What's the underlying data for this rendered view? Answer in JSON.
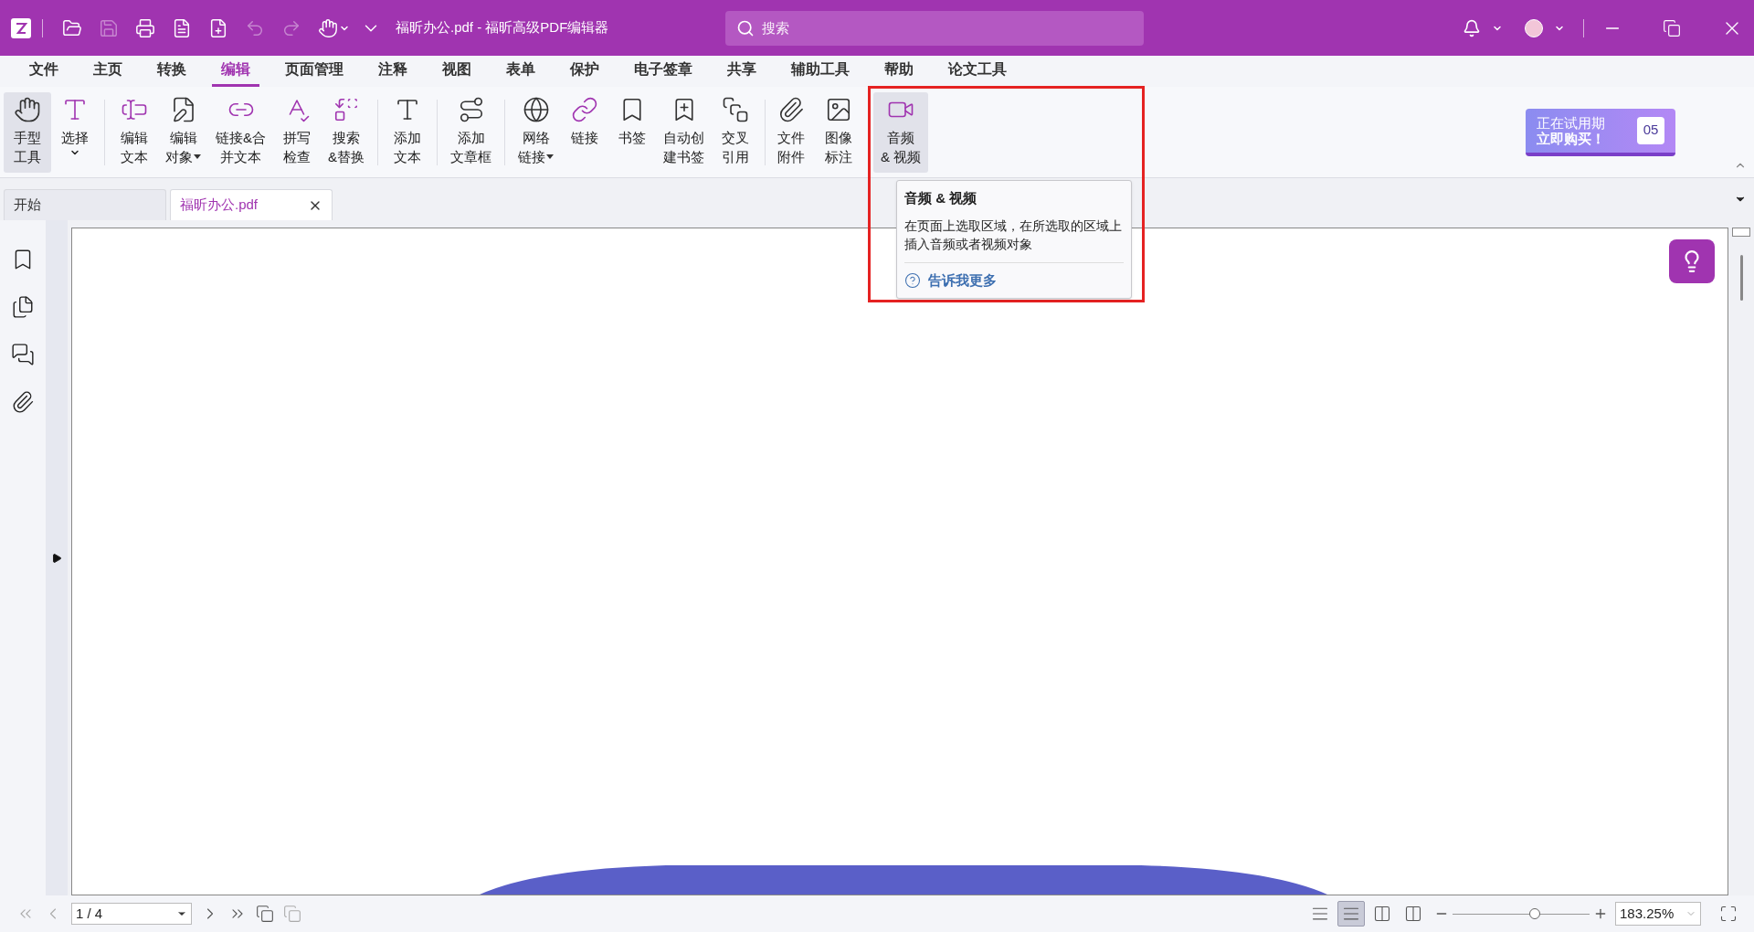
{
  "title_bar": {
    "quick_access": [
      {
        "kind": "open",
        "disabled": false
      },
      {
        "kind": "save",
        "disabled": true
      },
      {
        "kind": "print",
        "disabled": false
      },
      {
        "kind": "file",
        "disabled": false
      },
      {
        "kind": "new",
        "disabled": false
      },
      {
        "kind": "undo",
        "disabled": true
      },
      {
        "kind": "redo",
        "disabled": true
      },
      {
        "kind": "hand",
        "disabled": false
      }
    ],
    "title": "福昕办公.pdf - 福昕高级PDF编辑器",
    "search": {
      "placeholder": "搜索"
    }
  },
  "menu": [
    {
      "label": "文件",
      "selected": false
    },
    {
      "label": "主页",
      "selected": false
    },
    {
      "label": "转换",
      "selected": false
    },
    {
      "label": "编辑",
      "selected": true
    },
    {
      "label": "页面管理",
      "selected": false
    },
    {
      "label": "注释",
      "selected": false
    },
    {
      "label": "视图",
      "selected": false
    },
    {
      "label": "表单",
      "selected": false
    },
    {
      "label": "保护",
      "selected": false
    },
    {
      "label": "电子签章",
      "selected": false
    },
    {
      "label": "共享",
      "selected": false
    },
    {
      "label": "辅助工具",
      "selected": false
    },
    {
      "label": "帮助",
      "selected": false
    },
    {
      "label": "论文工具",
      "selected": false
    }
  ],
  "ribbon": {
    "groups": [
      {
        "items": [
          {
            "kind": "hand",
            "lines": [
              "手型",
              "工具"
            ],
            "dropdown": false,
            "selected": true
          },
          {
            "kind": "select",
            "lines": [
              "选择"
            ],
            "dropdown": true,
            "selected": false
          }
        ]
      },
      {
        "items": [
          {
            "kind": "edit-text",
            "lines": [
              "编辑",
              "文本"
            ],
            "dropdown": false,
            "selected": false
          },
          {
            "kind": "edit-object",
            "lines": [
              "编辑",
              "对象"
            ],
            "dropdown": true,
            "selected": false
          },
          {
            "kind": "link-merge",
            "lines": [
              "链接&合",
              "并文本"
            ],
            "dropdown": false,
            "selected": false
          },
          {
            "kind": "spell",
            "lines": [
              "拼写",
              "检查"
            ],
            "dropdown": false,
            "selected": false
          },
          {
            "kind": "replace",
            "lines": [
              "搜索",
              "&替换"
            ],
            "dropdown": false,
            "selected": false
          }
        ]
      },
      {
        "items": [
          {
            "kind": "add-text",
            "lines": [
              "添加",
              "文本"
            ],
            "dropdown": false,
            "selected": false
          }
        ]
      },
      {
        "items": [
          {
            "kind": "article",
            "lines": [
              "添加",
              "文章框"
            ],
            "dropdown": false,
            "selected": false
          }
        ]
      },
      {
        "items": [
          {
            "kind": "web-link",
            "lines": [
              "网络",
              "链接"
            ],
            "dropdown": true,
            "selected": false
          },
          {
            "kind": "link",
            "lines": [
              "链接"
            ],
            "dropdown": false,
            "selected": false
          },
          {
            "kind": "bookmark",
            "lines": [
              "书签"
            ],
            "dropdown": false,
            "selected": false
          },
          {
            "kind": "auto-bookmark",
            "lines": [
              "自动创",
              "建书签"
            ],
            "dropdown": false,
            "selected": false
          },
          {
            "kind": "cross-ref",
            "lines": [
              "交叉",
              "引用"
            ],
            "dropdown": false,
            "selected": false
          }
        ]
      },
      {
        "items": [
          {
            "kind": "attachment",
            "lines": [
              "文件",
              "附件"
            ],
            "dropdown": false,
            "selected": false
          },
          {
            "kind": "image-annot",
            "lines": [
              "图像",
              "标注"
            ],
            "dropdown": false,
            "selected": false
          },
          {
            "kind": "media",
            "lines": [
              "音频",
              "& 视频"
            ],
            "dropdown": false,
            "selected": true
          }
        ]
      }
    ]
  },
  "trial_badge": {
    "line_1": "正在试用期",
    "line_2": "立即购买！",
    "days": "05"
  },
  "doc_tabs": [
    {
      "label": "开始",
      "selected": false,
      "closable": false
    },
    {
      "label": "福昕办公.pdf",
      "selected": true,
      "closable": true
    }
  ],
  "tooltip": {
    "title": "音频 & 视频",
    "body": "在页面上选取区域，在所选取的区域上插入音频或者视频对象",
    "link": "告诉我更多"
  },
  "status_bar": {
    "page": "1 / 4",
    "views": [
      {
        "selected": false
      },
      {
        "selected": true
      },
      {
        "selected": false
      },
      {
        "selected": false
      }
    ],
    "zoom": {
      "level": 0.6,
      "value": "183.25%"
    }
  }
}
